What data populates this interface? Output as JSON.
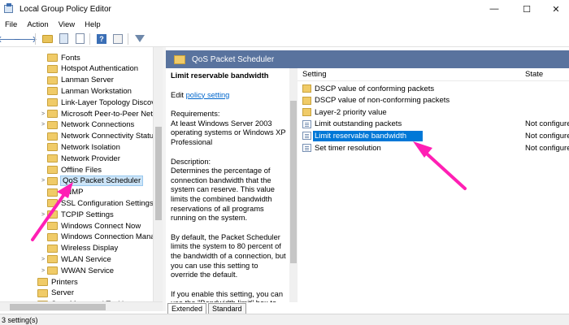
{
  "window": {
    "title": "Local Group Policy Editor",
    "minimize": "—",
    "maximize": "☐",
    "close": "✕"
  },
  "menu": [
    "File",
    "Action",
    "View",
    "Help"
  ],
  "toolbar": {
    "back": "🡐",
    "forward": "🡒"
  },
  "tree": {
    "items": [
      {
        "label": "Fonts",
        "expandable": false
      },
      {
        "label": "Hotspot Authentication",
        "expandable": false
      },
      {
        "label": "Lanman Server",
        "expandable": false
      },
      {
        "label": "Lanman Workstation",
        "expandable": false
      },
      {
        "label": "Link-Layer Topology Discove",
        "expandable": false
      },
      {
        "label": "Microsoft Peer-to-Peer Netv",
        "expandable": true
      },
      {
        "label": "Network Connections",
        "expandable": true
      },
      {
        "label": "Network Connectivity Status",
        "expandable": false
      },
      {
        "label": "Network Isolation",
        "expandable": false
      },
      {
        "label": "Network Provider",
        "expandable": false
      },
      {
        "label": "Offline Files",
        "expandable": false
      },
      {
        "label": "QoS Packet Scheduler",
        "expandable": true,
        "selected": true
      },
      {
        "label": "SNMP",
        "expandable": false
      },
      {
        "label": "SSL Configuration Settings",
        "expandable": false
      },
      {
        "label": "TCPIP Settings",
        "expandable": true
      },
      {
        "label": "Windows Connect Now",
        "expandable": false
      },
      {
        "label": "Windows Connection Mana",
        "expandable": false
      },
      {
        "label": "Wireless Display",
        "expandable": false
      },
      {
        "label": "WLAN Service",
        "expandable": true
      },
      {
        "label": "WWAN Service",
        "expandable": true
      },
      {
        "label": "Printers",
        "expandable": false,
        "top": true
      },
      {
        "label": "Server",
        "expandable": false,
        "top": true
      },
      {
        "label": "Start Menu and Taskbar",
        "expandable": true,
        "top": true
      }
    ]
  },
  "right_header": "QoS Packet Scheduler",
  "description": {
    "title": "Limit reservable bandwidth",
    "edit_prefix": "Edit ",
    "edit_link": "policy setting",
    "requirements": "Requirements:\nAt least Windows Server 2003 operating systems or Windows XP Professional",
    "description": "Description:\nDetermines the percentage of connection bandwidth that the system can reserve. This value limits the combined bandwidth reservations of all programs running on the system.",
    "default_text": "By default, the Packet Scheduler limits the system to 80 percent of the bandwidth of a connection, but you can use this setting to override the default.",
    "if_enabled": "If you enable this setting, you can use the \"Bandwidth limit\" box to"
  },
  "settings": {
    "col_setting": "Setting",
    "col_state": "State",
    "rows": [
      {
        "icon": "folder",
        "name": "DSCP value of conforming packets",
        "state": ""
      },
      {
        "icon": "folder",
        "name": "DSCP value of non-conforming packets",
        "state": ""
      },
      {
        "icon": "folder",
        "name": "Layer-2 priority value",
        "state": ""
      },
      {
        "icon": "policy",
        "name": "Limit outstanding packets",
        "state": "Not configured"
      },
      {
        "icon": "policy",
        "name": "Limit reservable bandwidth",
        "state": "Not configured",
        "selected": true
      },
      {
        "icon": "policy",
        "name": "Set timer resolution",
        "state": "Not configured"
      }
    ]
  },
  "tabs": [
    "Extended",
    "Standard"
  ],
  "status": "3 setting(s)",
  "colors": {
    "header_bg": "#59739e",
    "selection": "#0078d7",
    "arrow": "#ff1fb4",
    "folder": "#f0cb68"
  }
}
